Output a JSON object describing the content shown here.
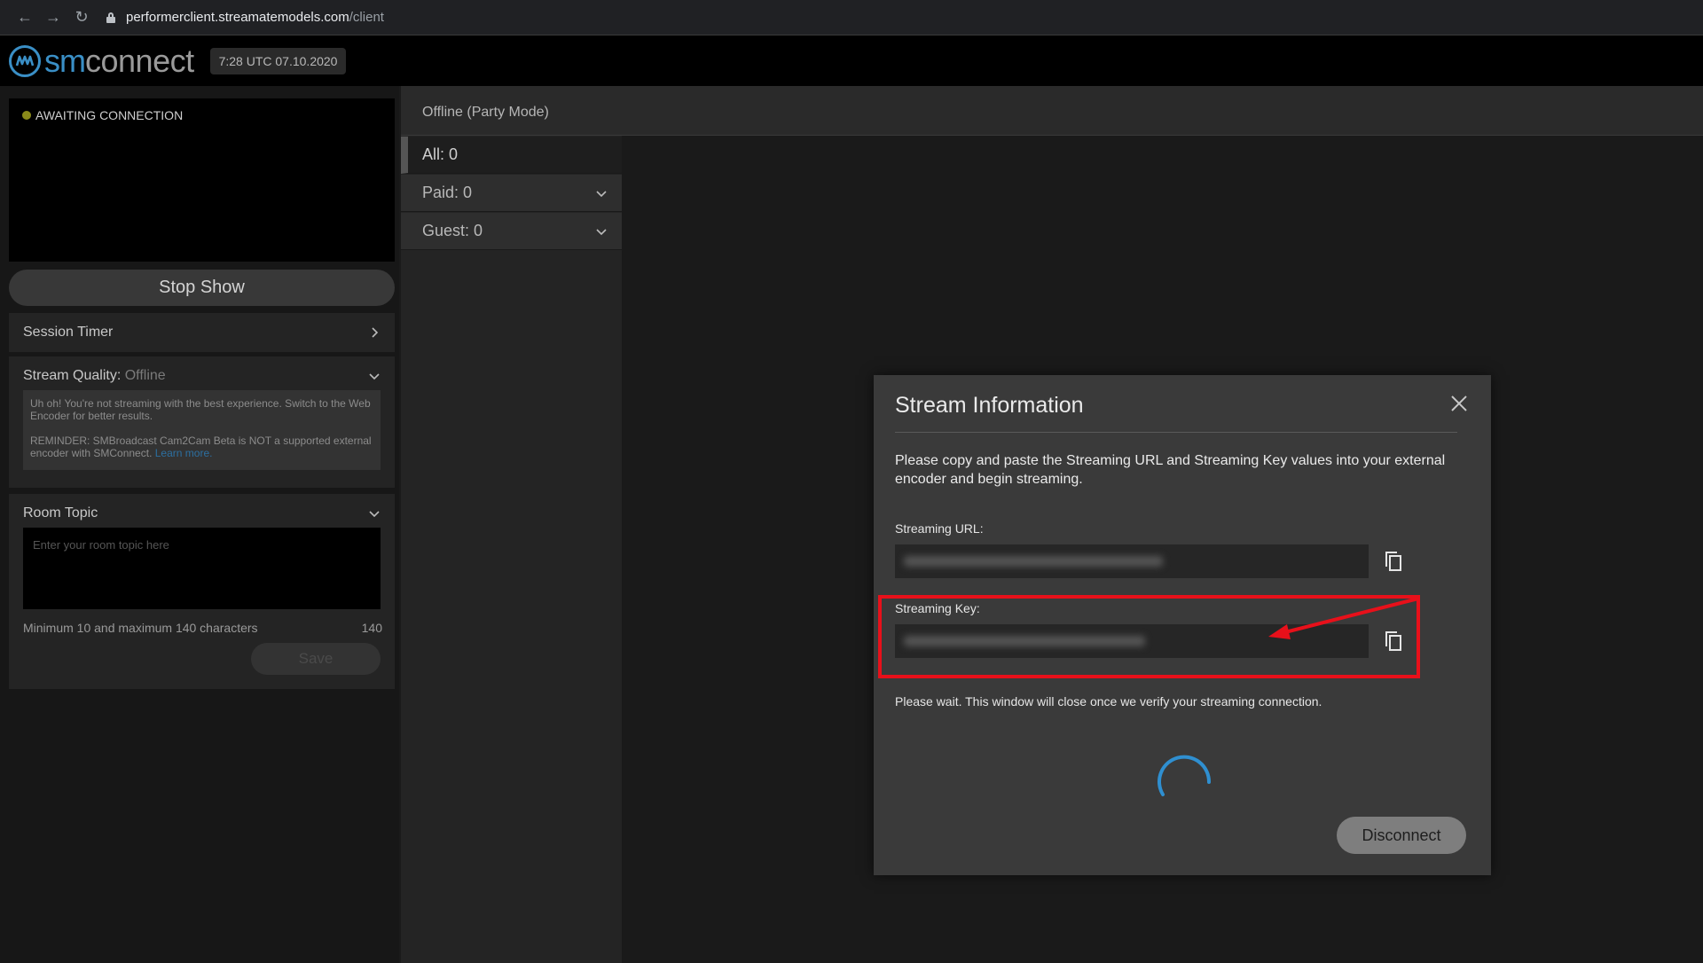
{
  "browser": {
    "url_host": "performerclient.streamatemodels.com",
    "url_path": "/client"
  },
  "header": {
    "logo_sm": "sm",
    "logo_connect": "connect",
    "clock": "7:28 UTC 07.10.2020"
  },
  "preview": {
    "status": "AWAITING CONNECTION"
  },
  "left": {
    "stop_show": "Stop Show",
    "session_timer": "Session Timer",
    "stream_quality_label": "Stream Quality:",
    "stream_quality_value": "Offline",
    "quality_message_1": "Uh oh! You're not streaming with the best experience. Switch to the Web Encoder for better results.",
    "quality_message_2": "REMINDER: SMBroadcast Cam2Cam Beta is NOT a supported external encoder with SMConnect.",
    "learn_more": "Learn more.",
    "room_topic": "Room Topic",
    "room_topic_placeholder": "Enter your room topic here",
    "room_topic_hint": "Minimum 10 and maximum 140 characters",
    "room_topic_count": "140",
    "save": "Save"
  },
  "middle": {
    "mode": "Offline (Party Mode)",
    "all": "All: 0",
    "paid": "Paid: 0",
    "guest": "Guest: 0"
  },
  "modal": {
    "title": "Stream Information",
    "description": "Please copy and paste the Streaming URL and Streaming Key values into your external encoder and begin streaming.",
    "url_label": "Streaming URL:",
    "key_label": "Streaming Key:",
    "wait_text": "Please wait. This window will close once we verify your streaming connection.",
    "disconnect": "Disconnect"
  },
  "colors": {
    "accent": "#3a8fc6",
    "highlight": "#e8101a",
    "spinner": "#2f8fd0"
  }
}
